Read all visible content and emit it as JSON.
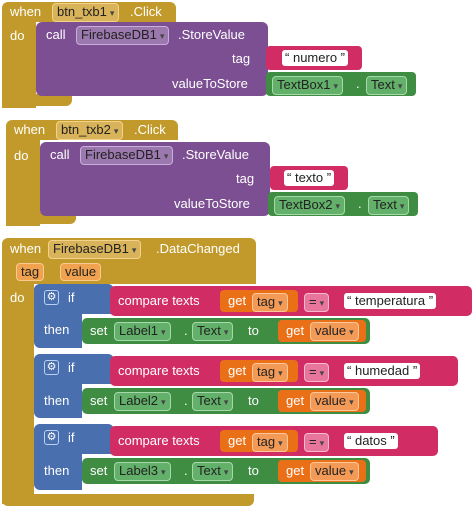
{
  "block1": {
    "when": "when",
    "component": "btn_txb1",
    "event": ".Click",
    "do": "do",
    "call": "call",
    "db": "FirebaseDB1",
    "method": ".StoreValue",
    "tag_label": "tag",
    "value_label": "valueToStore",
    "tag_value": "numero",
    "textbox": "TextBox1",
    "dot": ".",
    "text_prop": "Text"
  },
  "block2": {
    "when": "when",
    "component": "btn_txb2",
    "event": ".Click",
    "do": "do",
    "call": "call",
    "db": "FirebaseDB1",
    "method": ".StoreValue",
    "tag_label": "tag",
    "value_label": "valueToStore",
    "tag_value": "texto",
    "textbox": "TextBox2",
    "dot": ".",
    "text_prop": "Text"
  },
  "block3": {
    "when": "when",
    "component": "FirebaseDB1",
    "event": ".DataChanged",
    "params": [
      "tag",
      "value"
    ],
    "do": "do",
    "if_label": "if",
    "then_label": "then",
    "compare": "compare texts",
    "get": "get",
    "tag": "tag",
    "eq": "=",
    "set": "set",
    "to": "to",
    "value": "value",
    "text_prop": "Text",
    "dot": ".",
    "branches": [
      {
        "string": "temperatura",
        "label": "Label1"
      },
      {
        "string": "humedad",
        "label": "Label2"
      },
      {
        "string": "datos",
        "label": "Label3"
      }
    ]
  },
  "quote_open": "“",
  "quote_close": "”",
  "dropdown_glyph": "▾",
  "gear_glyph": "⚙"
}
